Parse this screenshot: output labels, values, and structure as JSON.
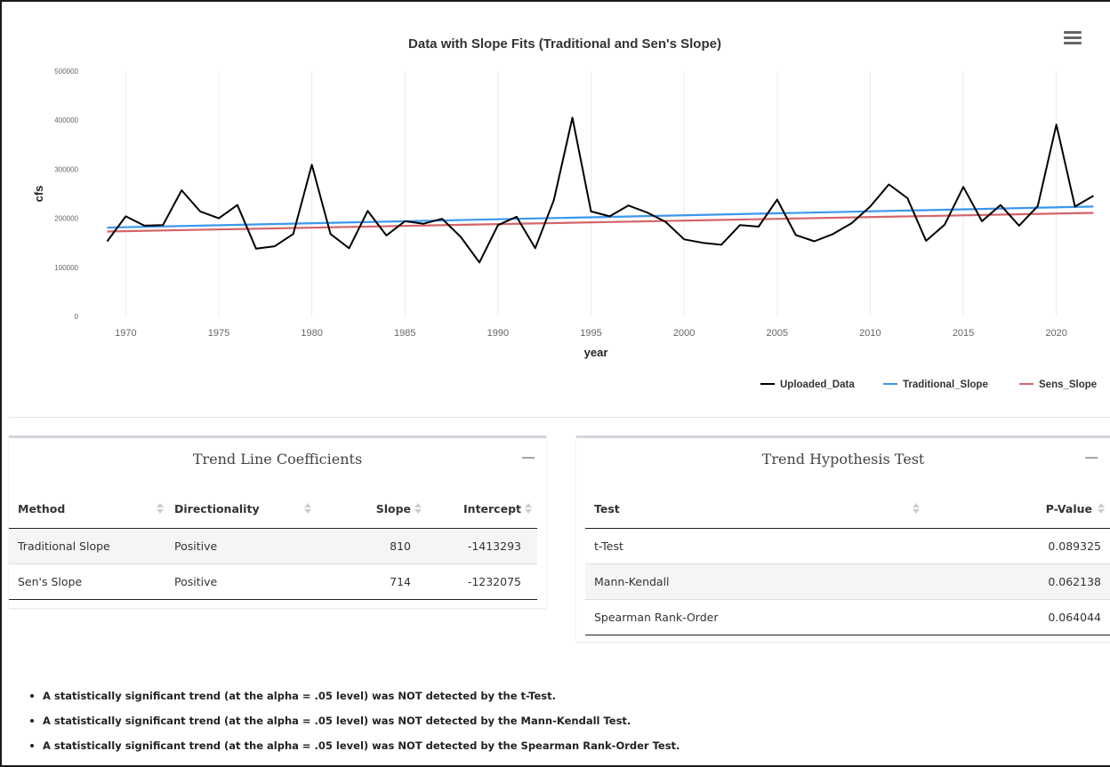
{
  "chart_data": {
    "type": "line",
    "title": "Data with Slope Fits (Traditional and Sen's Slope)",
    "xlabel": "year",
    "ylabel": "cfs",
    "xlim": [
      1968.5,
      2022.5
    ],
    "ylim": [
      0,
      500000
    ],
    "x_ticks": [
      1970,
      1975,
      1980,
      1985,
      1990,
      1995,
      2000,
      2005,
      2010,
      2015,
      2020
    ],
    "y_ticks": [
      0,
      100000,
      200000,
      300000,
      400000,
      500000
    ],
    "grid": "vertical",
    "legend_position": "bottom-right",
    "series": [
      {
        "name": "Uploaded_Data",
        "color": "#000000",
        "x": [
          1969,
          1970,
          1971,
          1972,
          1973,
          1974,
          1975,
          1976,
          1977,
          1978,
          1979,
          1980,
          1981,
          1982,
          1983,
          1984,
          1985,
          1986,
          1987,
          1988,
          1989,
          1990,
          1991,
          1992,
          1993,
          1994,
          1995,
          1996,
          1997,
          1998,
          1999,
          2000,
          2001,
          2002,
          2003,
          2004,
          2005,
          2006,
          2007,
          2008,
          2009,
          2010,
          2011,
          2012,
          2013,
          2014,
          2015,
          2016,
          2017,
          2018,
          2019,
          2020,
          2021,
          2022
        ],
        "y": [
          153000,
          204000,
          185000,
          186000,
          257000,
          214000,
          200000,
          227000,
          138000,
          143000,
          168000,
          309000,
          168000,
          139000,
          215000,
          165000,
          194000,
          189000,
          199000,
          162000,
          110000,
          186000,
          203000,
          139000,
          237000,
          405000,
          214000,
          204000,
          226000,
          212000,
          193000,
          157000,
          150000,
          146000,
          186000,
          183000,
          238000,
          166000,
          153000,
          168000,
          190000,
          224000,
          269000,
          241000,
          154000,
          187000,
          264000,
          194000,
          227000,
          185000,
          225000,
          391000,
          224000,
          246000
        ]
      },
      {
        "name": "Traditional_Slope",
        "color": "#3a97f0",
        "x": [
          1969,
          2022
        ],
        "y": [
          181000,
          224000
        ]
      },
      {
        "name": "Sens_Slope",
        "color": "#d4646a",
        "x": [
          1969,
          2022
        ],
        "y": [
          173000,
          211000
        ]
      }
    ]
  },
  "chart_menu_icon": "hamburger-menu-icon",
  "coefficients": {
    "title": "Trend Line Coefficients",
    "collapse_symbol": "−",
    "headers": [
      "Method",
      "Directionality",
      "Slope",
      "Intercept"
    ],
    "rows": [
      [
        "Traditional Slope",
        "Positive",
        "810",
        "-1413293"
      ],
      [
        "Sen's Slope",
        "Positive",
        "714",
        "-1232075"
      ]
    ]
  },
  "hypothesis": {
    "title": "Trend Hypothesis Test",
    "collapse_symbol": "−",
    "headers": [
      "Test",
      "P-Value"
    ],
    "rows": [
      [
        "t-Test",
        "0.089325"
      ],
      [
        "Mann-Kendall",
        "0.062138"
      ],
      [
        "Spearman Rank-Order",
        "0.064044"
      ]
    ]
  },
  "results": [
    "A statistically significant trend (at the alpha = .05 level) was NOT detected by the t-Test.",
    "A statistically significant trend (at the alpha = .05 level) was NOT detected by the Mann-Kendall Test.",
    "A statistically significant trend (at the alpha = .05 level) was NOT detected by the Spearman Rank-Order Test."
  ]
}
